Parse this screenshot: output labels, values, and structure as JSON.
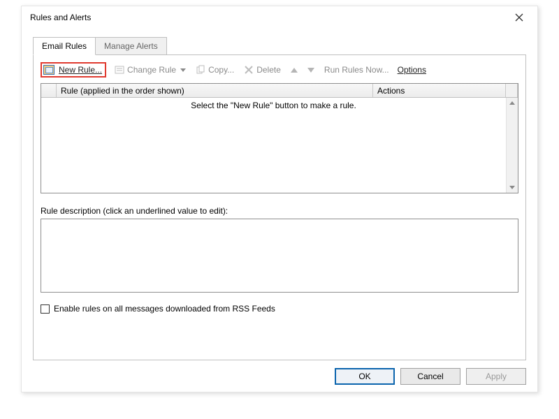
{
  "window": {
    "title": "Rules and Alerts"
  },
  "tabs": {
    "email_rules": "Email Rules",
    "manage_alerts": "Manage Alerts"
  },
  "toolbar": {
    "new_rule": "New Rule...",
    "change_rule": "Change Rule",
    "copy": "Copy...",
    "delete": "Delete",
    "run_rules_now": "Run Rules Now...",
    "options": "Options"
  },
  "grid": {
    "col_rule": "Rule (applied in the order shown)",
    "col_actions": "Actions",
    "empty_message": "Select the \"New Rule\" button to make a rule."
  },
  "description": {
    "label": "Rule description (click an underlined value to edit):"
  },
  "rss": {
    "label": "Enable rules on all messages downloaded from RSS Feeds"
  },
  "buttons": {
    "ok": "OK",
    "cancel": "Cancel",
    "apply": "Apply"
  }
}
